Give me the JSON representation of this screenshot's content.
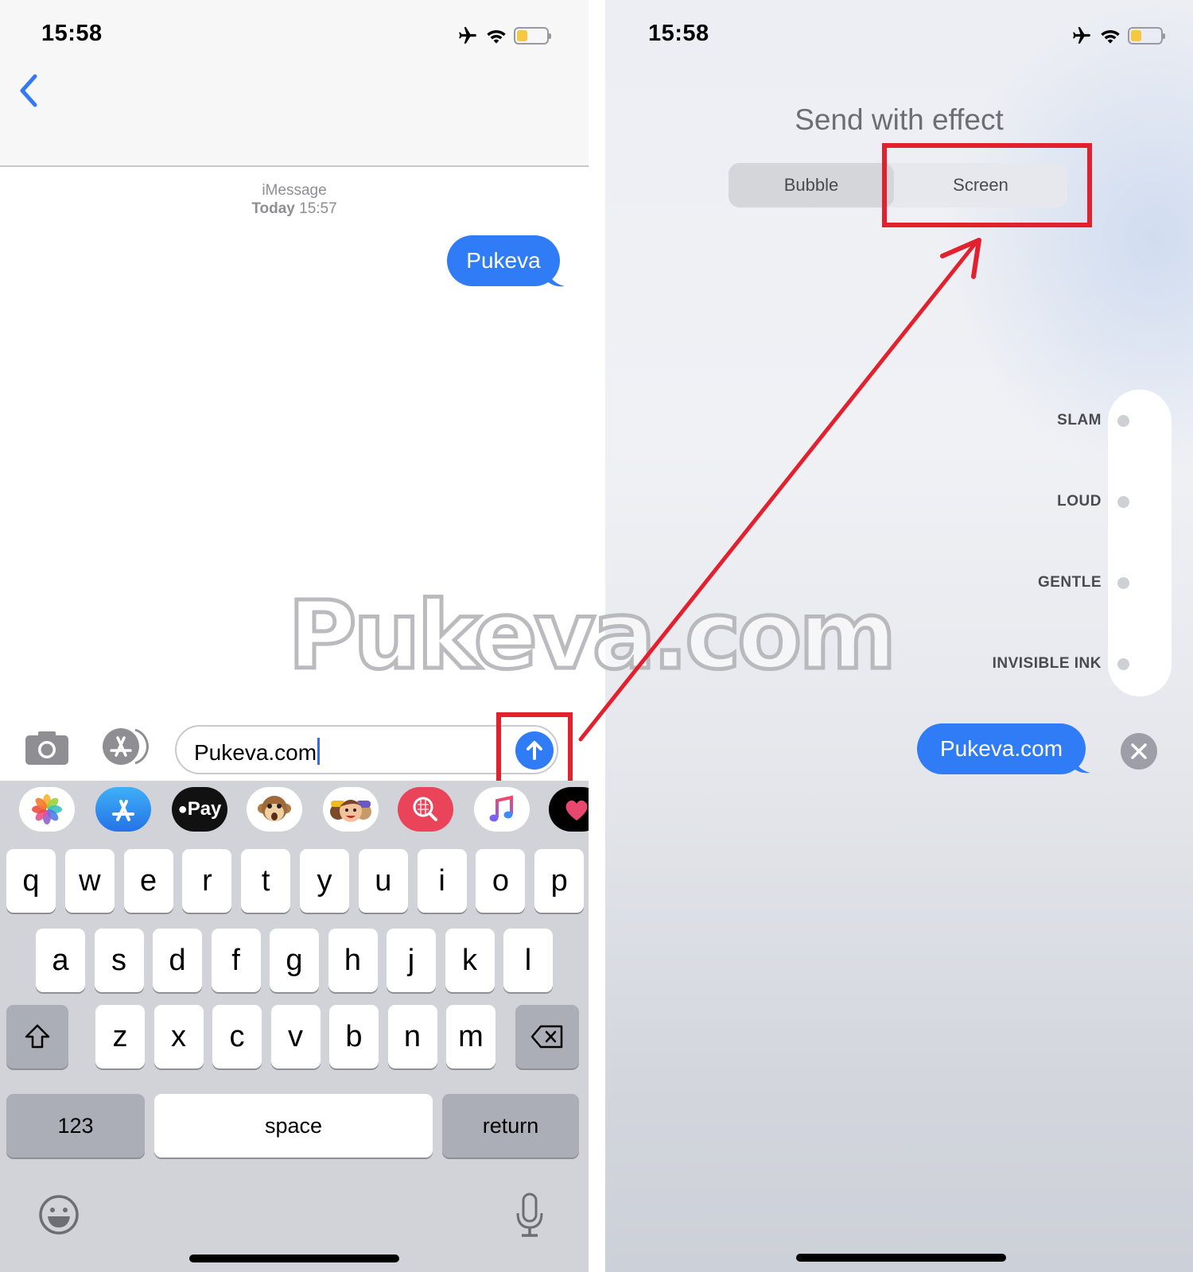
{
  "left_screen": {
    "status_bar": {
      "time": "15:58",
      "icons": [
        "airplane-icon",
        "wifi-icon",
        "battery-icon"
      ],
      "battery_level": 0.35
    },
    "nav": {
      "back_icon": "chevron-left-icon"
    },
    "thread": {
      "service": "iMessage",
      "timestamp_day": "Today",
      "timestamp_time": "15:57",
      "messages": [
        {
          "text": "Pukeva",
          "direction": "outgoing"
        }
      ]
    },
    "compose": {
      "camera_icon": "camera-icon",
      "apps_icon": "app-store-icon",
      "input_value": "Pukeva.com",
      "send_icon": "arrow-up-icon"
    },
    "app_strip": [
      {
        "name": "photos",
        "label": ""
      },
      {
        "name": "app-store",
        "label": ""
      },
      {
        "name": "apple-pay",
        "label": "Pay"
      },
      {
        "name": "animoji",
        "label": ""
      },
      {
        "name": "memoji",
        "label": ""
      },
      {
        "name": "image-search",
        "label": ""
      },
      {
        "name": "music",
        "label": ""
      },
      {
        "name": "digital-touch",
        "label": ""
      }
    ],
    "keyboard": {
      "row1": [
        "q",
        "w",
        "e",
        "r",
        "t",
        "y",
        "u",
        "i",
        "o",
        "p"
      ],
      "row2": [
        "a",
        "s",
        "d",
        "f",
        "g",
        "h",
        "j",
        "k",
        "l"
      ],
      "row3": [
        "z",
        "x",
        "c",
        "v",
        "b",
        "n",
        "m"
      ],
      "shift_icon": "shift-icon",
      "delete_icon": "delete-icon",
      "numbers_label": "123",
      "space_label": "space",
      "return_label": "return",
      "emoji_icon": "emoji-icon",
      "mic_icon": "microphone-icon"
    }
  },
  "right_screen": {
    "status_bar": {
      "time": "15:58",
      "icons": [
        "airplane-icon",
        "wifi-icon",
        "battery-icon"
      ],
      "battery_level": 0.35
    },
    "title": "Send with effect",
    "tabs": [
      {
        "label": "Bubble",
        "selected": true
      },
      {
        "label": "Screen",
        "selected": false
      }
    ],
    "effects": [
      "SLAM",
      "LOUD",
      "GENTLE",
      "INVISIBLE INK"
    ],
    "preview_message": "Pukeva.com",
    "cancel_icon": "close-icon"
  },
  "annotations": {
    "watermark": "Pukeva.com",
    "highlight_color": "#e3212e",
    "highlighted_targets": [
      "send-button",
      "tab-screen"
    ]
  },
  "colors": {
    "imessage_blue": "#2f7cf6",
    "keyboard_bg": "#d2d3d8",
    "battery_yellow": "#f6c840"
  }
}
